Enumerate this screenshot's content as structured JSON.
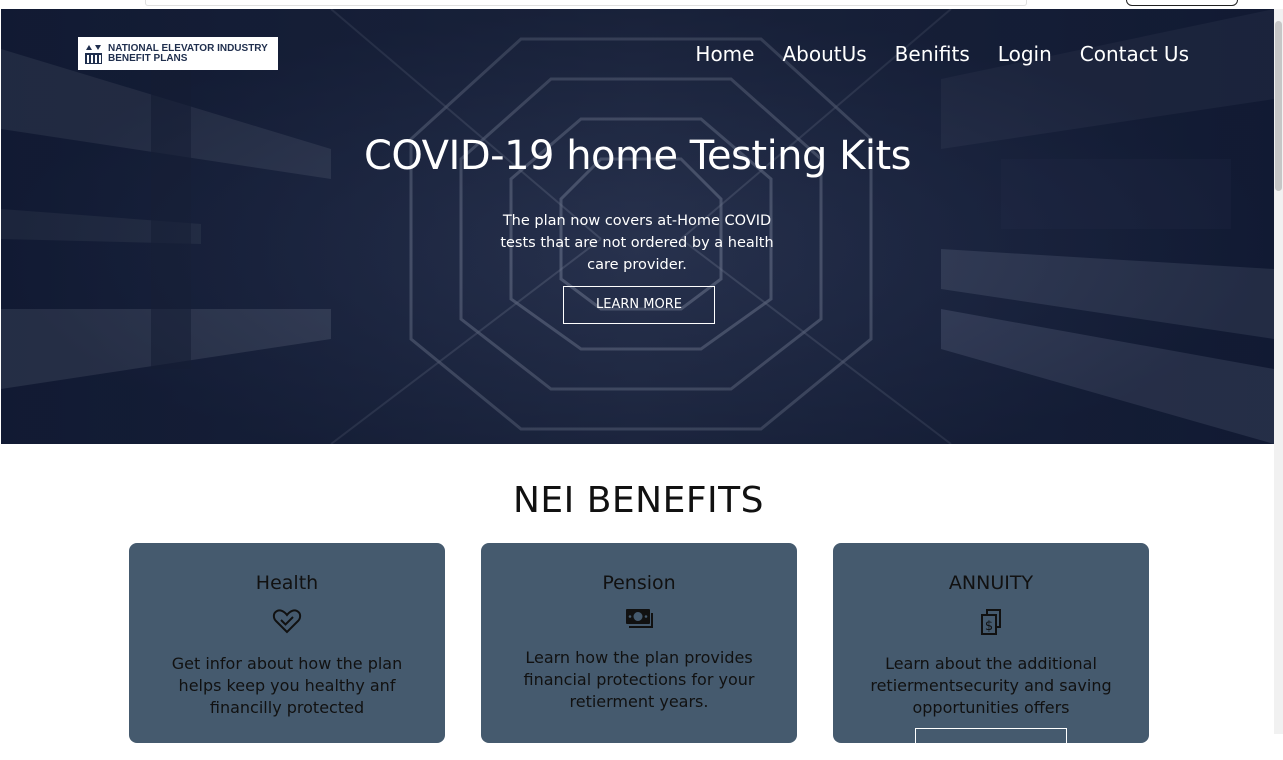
{
  "header": {
    "logo_line1": "NATIONAL ELEVATOR INDUSTRY",
    "logo_line2": "BENEFIT PLANS",
    "nav": [
      "Home",
      "AboutUs",
      "Benifits",
      "Login",
      "Contact Us"
    ]
  },
  "hero": {
    "title": "COVID-19 home Testing Kits",
    "subtitle": "The plan now covers at-Home COVID tests that are not ordered by a health care provider.",
    "button": "LEARN MORE"
  },
  "benefits": {
    "title": "NEI BENEFITS",
    "cards": [
      {
        "title": "Health",
        "icon": "heart-check-icon",
        "text": "Get infor about how the plan helps keep you healthy anf financilly protected"
      },
      {
        "title": "Pension",
        "icon": "money-bill-icon",
        "text": "Learn how the plan provides financial protections for your retierment years."
      },
      {
        "title": "ANNUITY",
        "icon": "dollar-files-icon",
        "text": "Learn about the additional retiermentsecurity and saving opportunities offers"
      }
    ]
  },
  "colors": {
    "card_bg": "#455a6e",
    "hero_overlay": "#15203a",
    "logo_text": "#1f2e4d"
  }
}
